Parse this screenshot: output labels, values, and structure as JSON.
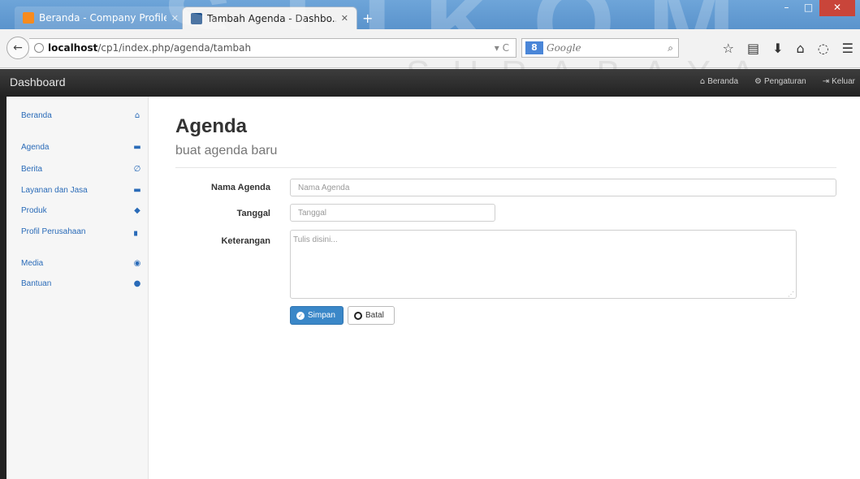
{
  "browser": {
    "tabs": [
      {
        "title": "Beranda - Company Profile",
        "active": false
      },
      {
        "title": "Tambah Agenda - Dashbo...",
        "active": true
      }
    ],
    "url_host": "localhost",
    "url_path": "/cp1/index.php/agenda/tambah",
    "search_engine_label": "8",
    "search_placeholder": "Google",
    "tool_icons": [
      "star-icon",
      "reading-list-icon",
      "download-icon",
      "home-icon",
      "pocket-icon",
      "menu-icon"
    ]
  },
  "appbar": {
    "brand": "Dashboard",
    "links": [
      {
        "icon": "home-icon",
        "label": "Beranda"
      },
      {
        "icon": "gear-icon",
        "label": "Pengaturan"
      },
      {
        "icon": "logout-icon",
        "label": "Keluar"
      }
    ]
  },
  "sidebar": {
    "items": [
      {
        "label": "Beranda",
        "icon": "home-icon"
      },
      {
        "label": "Agenda",
        "icon": "calendar-icon"
      },
      {
        "label": "Berita",
        "icon": "paperclip-icon"
      },
      {
        "label": "Layanan dan Jasa",
        "icon": "briefcase-icon"
      },
      {
        "label": "Produk",
        "icon": "tag-icon"
      },
      {
        "label": "Profil Perusahaan",
        "icon": "bar-chart-icon"
      },
      {
        "label": "Media",
        "icon": "camera-icon"
      },
      {
        "label": "Bantuan",
        "icon": "question-icon"
      }
    ]
  },
  "main": {
    "title": "Agenda",
    "subtitle": "buat agenda baru",
    "form": {
      "nama_agenda_label": "Nama Agenda",
      "nama_agenda_placeholder": "Nama Agenda",
      "tanggal_label": "Tanggal",
      "tanggal_placeholder": "Tanggal",
      "keterangan_label": "Keterangan",
      "keterangan_placeholder": "Tulis disini...",
      "save_label": "Simpan",
      "cancel_label": "Batal"
    }
  },
  "watermark": {
    "big": "STIKOM",
    "small": "SURABAYA"
  },
  "colors": {
    "link": "#2a6bb8",
    "primary_button": "#3a87c8",
    "appbar": "#2b2b2b",
    "titlebar": "#5a93cc"
  }
}
